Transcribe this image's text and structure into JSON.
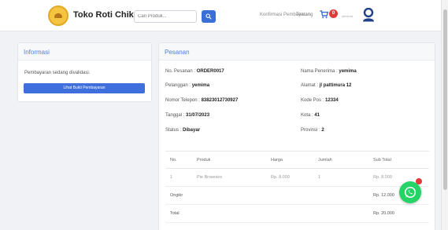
{
  "navbar": {
    "brand": "Toko Roti Chika",
    "search_placeholder": "Cari Produk...",
    "links": [
      "Konfirmasi Pembayaran",
      "Tentang"
    ],
    "cart_count": "0",
    "user_name": "yemima",
    "accent_color": "#3a6fd8"
  },
  "info": {
    "title": "Informasi",
    "message": "Pembayaran sedang divalidasi.",
    "button_label": "Lihat Bukti Pembayaran"
  },
  "order": {
    "title": "Pesanan",
    "left_fields": [
      {
        "label": "No. Pesanan : ",
        "value": "ORDER0017"
      },
      {
        "label": "Pelanggan : ",
        "value": "yemima"
      },
      {
        "label": "Nomor Telepon : ",
        "value": "83823012730927"
      },
      {
        "label": "Tanggal : ",
        "value": "31/07/2023"
      },
      {
        "label": "Status : ",
        "value": "Dibayar"
      }
    ],
    "right_fields": [
      {
        "label": "Nama Penerima : ",
        "value": "yemima"
      },
      {
        "label": "Alamat : ",
        "value": "jl pattimura 12"
      },
      {
        "label": "Kode Pos : ",
        "value": "12334"
      },
      {
        "label": "Kota : ",
        "value": "41"
      },
      {
        "label": "Provinsi : ",
        "value": "2"
      }
    ],
    "table": {
      "headers": [
        "No.",
        "Produk",
        "Harga",
        "Jumlah",
        "Sub Total"
      ],
      "rows": [
        [
          "1",
          "Pie Brownies",
          "Rp. 8.000",
          "1",
          "Rp. 8.000"
        ]
      ],
      "shipping_label": "Ongkir",
      "shipping_value": "Rp. 12.000",
      "total_label": "Total",
      "total_value": "Rp. 20.000"
    }
  },
  "icons": {
    "search": "search-icon",
    "cart": "cart-icon",
    "user": "user-icon",
    "whatsapp": "whatsapp-icon"
  },
  "colors": {
    "primary": "#3f6fdc",
    "whatsapp": "#25d366",
    "badge": "#e23b3b"
  }
}
